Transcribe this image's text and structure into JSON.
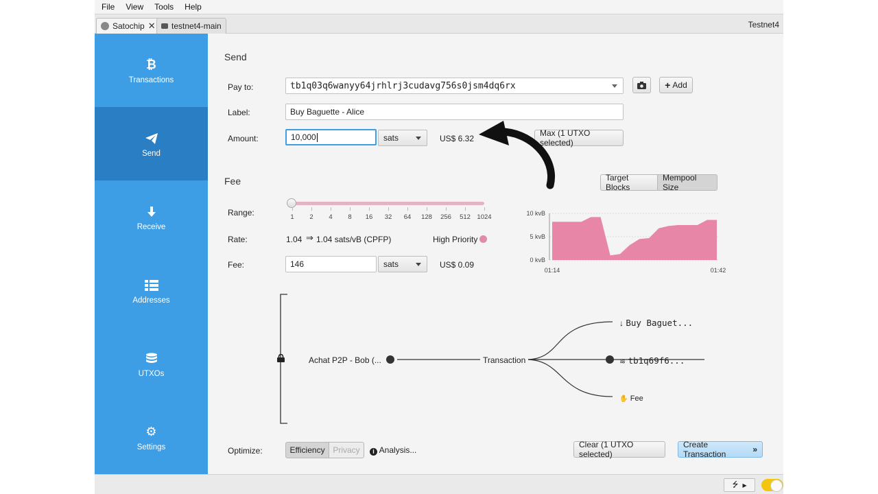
{
  "menu": [
    "File",
    "View",
    "Tools",
    "Help"
  ],
  "tabs": [
    {
      "label": "Satochip",
      "close": "✕"
    },
    {
      "label": "testnet4-main"
    }
  ],
  "network": "Testnet4",
  "sidebar": {
    "items": [
      {
        "label": "Transactions",
        "icon": "bitcoin-icon"
      },
      {
        "label": "Send",
        "icon": "paper-plane-icon"
      },
      {
        "label": "Receive",
        "icon": "arrow-down-icon"
      },
      {
        "label": "Addresses",
        "icon": "list-icon"
      },
      {
        "label": "UTXOs",
        "icon": "coins-icon"
      },
      {
        "label": "Settings",
        "icon": "gear-icon"
      }
    ],
    "active": "Send"
  },
  "send": {
    "title": "Send",
    "pay_to_label": "Pay to:",
    "pay_to_value": "tb1q03q6wanyy64jrhlrj3cudavg756s0jsm4dq6rx",
    "add_label": "Add",
    "label_label": "Label:",
    "label_value": "Buy Baguette - Alice",
    "amount_label": "Amount:",
    "amount_value": "10,000",
    "amount_unit": "sats",
    "amount_fiat": "US$ 6.32",
    "max_label": "Max (1 UTXO selected)"
  },
  "fee": {
    "title": "Fee",
    "target_blocks": "Target Blocks",
    "mempool_size": "Mempool Size",
    "range_label": "Range:",
    "ticks": [
      "1",
      "2",
      "4",
      "8",
      "16",
      "32",
      "64",
      "128",
      "256",
      "512",
      "1024"
    ],
    "rate_label": "Rate:",
    "rate_value": "1.04",
    "rate_cpfp": "1.04 sats/vB (CPFP)",
    "priority": "High Priority",
    "priority_color": "#e38aa8",
    "fee_label": "Fee:",
    "fee_value": "146",
    "fee_unit": "sats",
    "fee_fiat": "US$ 0.09"
  },
  "chart_data": {
    "type": "area",
    "yticks": [
      "10 kvB",
      "5 kvB",
      "0 kvB"
    ],
    "ylim": [
      0,
      10
    ],
    "xticks": [
      "01:14",
      "01:42"
    ],
    "values": [
      8.2,
      8.2,
      8.2,
      8.2,
      9.2,
      9.2,
      1.0,
      1.3,
      3.2,
      4.5,
      4.7,
      6.8,
      7.3,
      7.5,
      7.5,
      7.5,
      8.6,
      8.6
    ],
    "color": "#e886a8"
  },
  "diagram": {
    "input": "Achat P2P - Bob (...",
    "tx": "Transaction",
    "out1": "Buy Baguet...",
    "out2": "tb1q69f6...",
    "out3": "Fee"
  },
  "optimize": {
    "label": "Optimize:",
    "efficiency": "Efficiency",
    "privacy": "Privacy",
    "analysis": "Analysis..."
  },
  "actions": {
    "clear": "Clear (1 UTXO selected)",
    "create": "Create Transaction"
  }
}
